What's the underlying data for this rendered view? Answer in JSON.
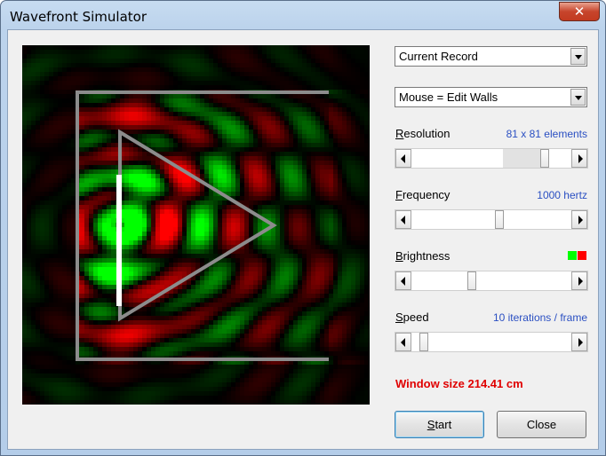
{
  "window": {
    "title": "Wavefront Simulator",
    "close_glyph": "✕"
  },
  "record_select": {
    "value": "Current Record"
  },
  "mouse_select": {
    "value": "Mouse = Edit Walls"
  },
  "resolution": {
    "label": "Resolution",
    "mnemonic": "R",
    "rest": "esolution",
    "value": "81 x 81 elements",
    "slider_fraction": 0.85
  },
  "frequency": {
    "label": "Frequency",
    "mnemonic": "F",
    "rest": "requency",
    "value": "1000 hertz",
    "slider_fraction": 0.55
  },
  "brightness": {
    "label": "Brightness",
    "mnemonic": "B",
    "rest": "rightness",
    "slider_fraction": 0.37,
    "swatch_colors": [
      "#00ff00",
      "#ff0000"
    ]
  },
  "speed": {
    "label": "Speed",
    "mnemonic": "S",
    "rest": "peed",
    "value": "10 iterations / frame",
    "slider_fraction": 0.05
  },
  "status": {
    "window_size": "Window size 214.41 cm"
  },
  "buttons": {
    "start": "Start",
    "start_mnemonic": "S",
    "start_rest": "tart",
    "close": "Close"
  },
  "colors": {
    "accent": "#2a4fc2",
    "warning": "#e00000"
  }
}
